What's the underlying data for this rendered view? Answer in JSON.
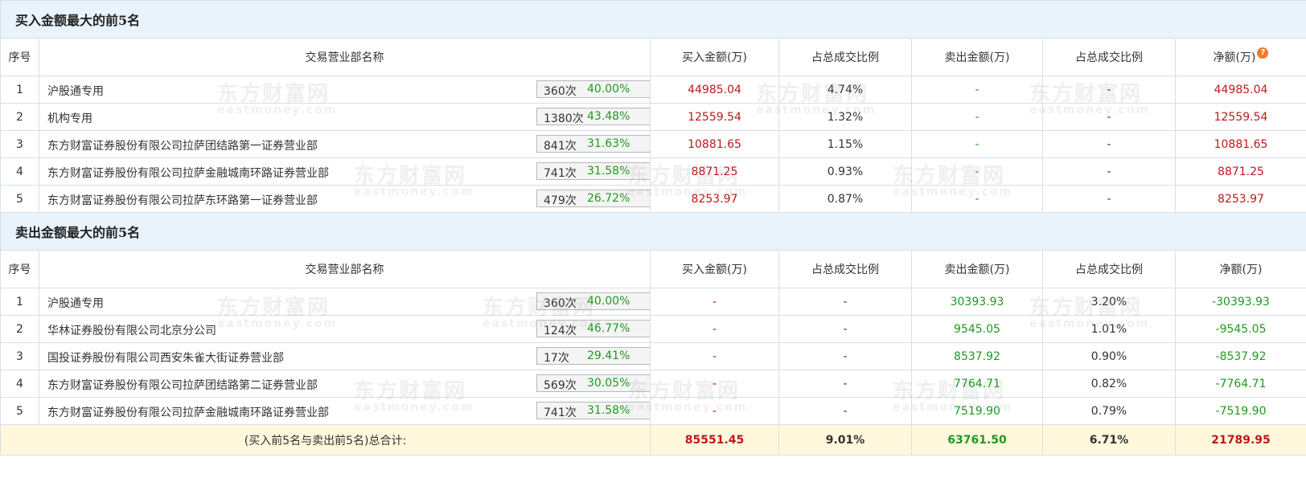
{
  "watermark": {
    "text": "东方财富网",
    "sub": "eastmoney.com"
  },
  "headers": {
    "idx": "序号",
    "name": "交易营业部名称",
    "buy": "买入金额(万)",
    "buy_pct": "占总成交比例",
    "sell": "卖出金额(万)",
    "sell_pct": "占总成交比例",
    "net": "净额(万)"
  },
  "buy_section": {
    "title": "买入金额最大的前5名",
    "rows": [
      {
        "idx": "1",
        "name": "沪股通专用",
        "count": "360次",
        "rate": "40.00%",
        "icon": "question-icon",
        "buy": "44985.04",
        "buy_pct": "4.74%",
        "sell": "-",
        "sell_pct": "-",
        "net": "44985.04"
      },
      {
        "idx": "2",
        "name": "机构专用",
        "count": "1380次",
        "rate": "43.48%",
        "icon": "play-icon",
        "buy": "12559.54",
        "buy_pct": "1.32%",
        "sell": "-",
        "sell_pct": "-",
        "net": "12559.54"
      },
      {
        "idx": "3",
        "name": "东方财富证券股份有限公司拉萨团结路第一证券营业部",
        "count": "841次",
        "rate": "31.63%",
        "icon": "play-icon",
        "buy": "10881.65",
        "buy_pct": "1.15%",
        "sell": "-",
        "sell_pct": "-",
        "net": "10881.65"
      },
      {
        "idx": "4",
        "name": "东方财富证券股份有限公司拉萨金融城南环路证券营业部",
        "count": "741次",
        "rate": "31.58%",
        "icon": "play-icon",
        "buy": "8871.25",
        "buy_pct": "0.93%",
        "sell": "-",
        "sell_pct": "-",
        "net": "8871.25"
      },
      {
        "idx": "5",
        "name": "东方财富证券股份有限公司拉萨东环路第一证券营业部",
        "count": "479次",
        "rate": "26.72%",
        "icon": "play-icon",
        "buy": "8253.97",
        "buy_pct": "0.87%",
        "sell": "-",
        "sell_pct": "-",
        "net": "8253.97"
      }
    ]
  },
  "sell_section": {
    "title": "卖出金额最大的前5名",
    "rows": [
      {
        "idx": "1",
        "name": "沪股通专用",
        "count": "360次",
        "rate": "40.00%",
        "icon": "question-icon",
        "buy": "-",
        "buy_pct": "-",
        "sell": "30393.93",
        "sell_pct": "3.20%",
        "net": "-30393.93"
      },
      {
        "idx": "2",
        "name": "华林证券股份有限公司北京分公司",
        "count": "124次",
        "rate": "46.77%",
        "icon": "play-icon",
        "buy": "-",
        "buy_pct": "-",
        "sell": "9545.05",
        "sell_pct": "1.01%",
        "net": "-9545.05"
      },
      {
        "idx": "3",
        "name": "国投证券股份有限公司西安朱雀大街证券营业部",
        "count": "17次",
        "rate": "29.41%",
        "icon": "play-icon",
        "buy": "-",
        "buy_pct": "-",
        "sell": "8537.92",
        "sell_pct": "0.90%",
        "net": "-8537.92"
      },
      {
        "idx": "4",
        "name": "东方财富证券股份有限公司拉萨团结路第二证券营业部",
        "count": "569次",
        "rate": "30.05%",
        "icon": "play-icon",
        "buy": "-",
        "buy_pct": "-",
        "sell": "7764.71",
        "sell_pct": "0.82%",
        "net": "-7764.71"
      },
      {
        "idx": "5",
        "name": "东方财富证券股份有限公司拉萨金融城南环路证券营业部",
        "count": "741次",
        "rate": "31.58%",
        "icon": "play-icon",
        "buy": "-",
        "buy_pct": "-",
        "sell": "7519.90",
        "sell_pct": "0.79%",
        "net": "-7519.90"
      }
    ]
  },
  "total": {
    "label": "(买入前5名与卖出前5名)总合计:",
    "buy": "85551.45",
    "buy_pct": "9.01%",
    "sell": "63761.50",
    "sell_pct": "6.71%",
    "net": "21789.95"
  },
  "colors": {
    "buy": "#c0181b",
    "sell": "#1f9a1f",
    "header_bg": "#e9f3fb",
    "total_bg": "#fff8dc"
  }
}
